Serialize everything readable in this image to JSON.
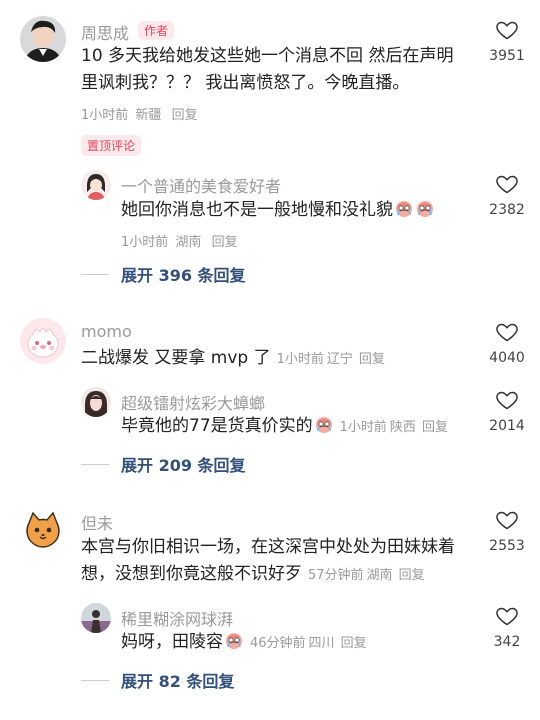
{
  "comments": [
    {
      "name": "周思成",
      "author_tag": "作者",
      "lines": [
        "10 多天我给她发这些她一个消息不回 然后在声明",
        "里讽刺我？？？ 我出离愤怒了。今晚直播。"
      ],
      "time": "1小时前",
      "location": "新疆",
      "reply": "回复",
      "likes": "3951",
      "pin_tag": "置顶评论",
      "sub": {
        "name": "一个普通的美食爱好者",
        "text": "她回你消息也不是一般地慢和没礼貌",
        "time": "1小时前",
        "location": "湖南",
        "reply": "回复",
        "likes": "2382"
      },
      "expand": "展开 396 条回复"
    },
    {
      "name": "momo",
      "text": "二战爆发 又要拿 mvp 了",
      "time": "1小时前",
      "location": "辽宁",
      "reply": "回复",
      "likes": "4040",
      "sub": {
        "name": "超级镭射炫彩大蟑螂",
        "text": "毕竟他的77是货真价实的",
        "time": "1小时前",
        "location": "陕西",
        "reply": "回复",
        "likes": "2014"
      },
      "expand": "展开 209 条回复"
    },
    {
      "name": "但未",
      "lines": [
        "本宫与你旧相识一场，在这深宫中处处为田妹妹着",
        "想，没想到你竟这般不识好歹"
      ],
      "time": "57分钟前",
      "location": "湖南",
      "reply": "回复",
      "likes": "2553",
      "sub": {
        "name": "稀里糊涂网球湃",
        "text": "妈呀，田陵容",
        "time": "46分钟前",
        "location": "四川",
        "reply": "回复",
        "likes": "342"
      },
      "expand": "展开 82 条回复"
    }
  ],
  "icons": {
    "like": "heart-outline-icon",
    "emoji": "crying-face-emoji"
  }
}
